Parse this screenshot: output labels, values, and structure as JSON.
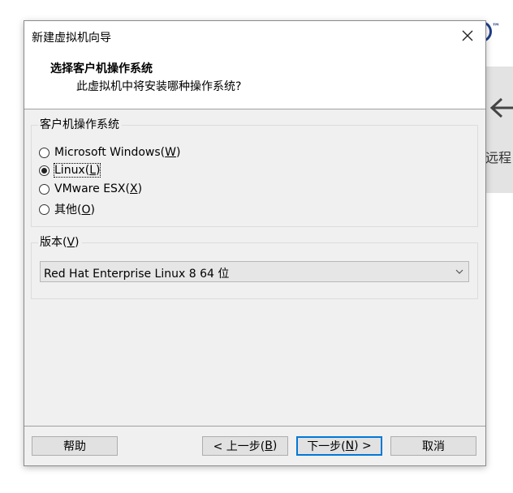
{
  "background": {
    "tm_mark": "™",
    "remote_label": "远程"
  },
  "window": {
    "title": "新建虚拟机向导"
  },
  "header": {
    "title": "选择客户机操作系统",
    "subtitle": "此虚拟机中将安装哪种操作系统?"
  },
  "guest_os": {
    "group_label": "客户机操作系统",
    "selected": "linux",
    "options": [
      {
        "id": "windows",
        "text": "Microsoft Windows(",
        "mnemonic": "W",
        "suffix": ")"
      },
      {
        "id": "linux",
        "text": "Linux(",
        "mnemonic": "L",
        "suffix": ")"
      },
      {
        "id": "esx",
        "text": "VMware ESX(",
        "mnemonic": "X",
        "suffix": ")"
      },
      {
        "id": "other",
        "text": "其他(",
        "mnemonic": "O",
        "suffix": ")"
      }
    ]
  },
  "version": {
    "group_label": "版本(",
    "group_mnemonic": "V",
    "group_suffix": ")",
    "selected_value": "Red Hat Enterprise Linux 8 64 位"
  },
  "buttons": {
    "help": "帮助",
    "back_prefix": "< 上一步(",
    "back_mnemonic": "B",
    "back_suffix": ")",
    "next_prefix": "下一步(",
    "next_mnemonic": "N",
    "next_suffix": ") >",
    "cancel": "取消"
  },
  "colors": {
    "accent": "#0078d7",
    "panel": "#f0f0f0",
    "brand": "#1f3c88"
  }
}
